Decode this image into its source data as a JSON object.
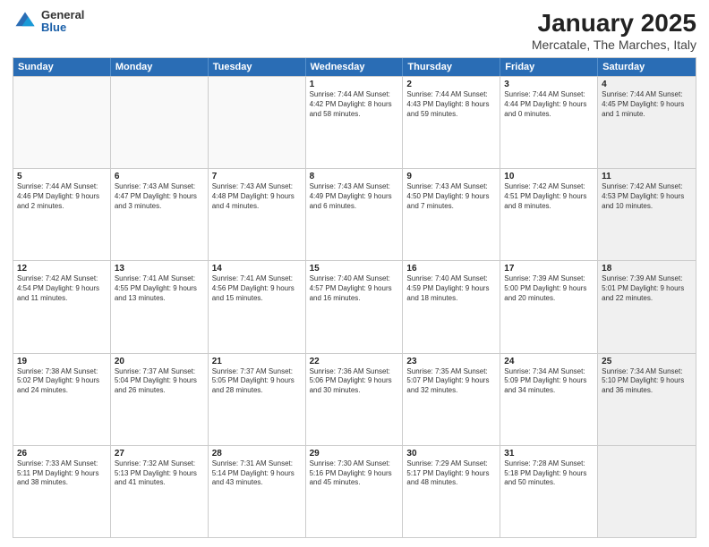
{
  "logo": {
    "general": "General",
    "blue": "Blue"
  },
  "header": {
    "title": "January 2025",
    "subtitle": "Mercatale, The Marches, Italy"
  },
  "weekdays": [
    "Sunday",
    "Monday",
    "Tuesday",
    "Wednesday",
    "Thursday",
    "Friday",
    "Saturday"
  ],
  "rows": [
    [
      {
        "day": "",
        "text": "",
        "empty": true
      },
      {
        "day": "",
        "text": "",
        "empty": true
      },
      {
        "day": "",
        "text": "",
        "empty": true
      },
      {
        "day": "1",
        "text": "Sunrise: 7:44 AM\nSunset: 4:42 PM\nDaylight: 8 hours and 58 minutes."
      },
      {
        "day": "2",
        "text": "Sunrise: 7:44 AM\nSunset: 4:43 PM\nDaylight: 8 hours and 59 minutes."
      },
      {
        "day": "3",
        "text": "Sunrise: 7:44 AM\nSunset: 4:44 PM\nDaylight: 9 hours and 0 minutes."
      },
      {
        "day": "4",
        "text": "Sunrise: 7:44 AM\nSunset: 4:45 PM\nDaylight: 9 hours and 1 minute.",
        "shaded": true
      }
    ],
    [
      {
        "day": "5",
        "text": "Sunrise: 7:44 AM\nSunset: 4:46 PM\nDaylight: 9 hours and 2 minutes."
      },
      {
        "day": "6",
        "text": "Sunrise: 7:43 AM\nSunset: 4:47 PM\nDaylight: 9 hours and 3 minutes."
      },
      {
        "day": "7",
        "text": "Sunrise: 7:43 AM\nSunset: 4:48 PM\nDaylight: 9 hours and 4 minutes."
      },
      {
        "day": "8",
        "text": "Sunrise: 7:43 AM\nSunset: 4:49 PM\nDaylight: 9 hours and 6 minutes."
      },
      {
        "day": "9",
        "text": "Sunrise: 7:43 AM\nSunset: 4:50 PM\nDaylight: 9 hours and 7 minutes."
      },
      {
        "day": "10",
        "text": "Sunrise: 7:42 AM\nSunset: 4:51 PM\nDaylight: 9 hours and 8 minutes."
      },
      {
        "day": "11",
        "text": "Sunrise: 7:42 AM\nSunset: 4:53 PM\nDaylight: 9 hours and 10 minutes.",
        "shaded": true
      }
    ],
    [
      {
        "day": "12",
        "text": "Sunrise: 7:42 AM\nSunset: 4:54 PM\nDaylight: 9 hours and 11 minutes."
      },
      {
        "day": "13",
        "text": "Sunrise: 7:41 AM\nSunset: 4:55 PM\nDaylight: 9 hours and 13 minutes."
      },
      {
        "day": "14",
        "text": "Sunrise: 7:41 AM\nSunset: 4:56 PM\nDaylight: 9 hours and 15 minutes."
      },
      {
        "day": "15",
        "text": "Sunrise: 7:40 AM\nSunset: 4:57 PM\nDaylight: 9 hours and 16 minutes."
      },
      {
        "day": "16",
        "text": "Sunrise: 7:40 AM\nSunset: 4:59 PM\nDaylight: 9 hours and 18 minutes."
      },
      {
        "day": "17",
        "text": "Sunrise: 7:39 AM\nSunset: 5:00 PM\nDaylight: 9 hours and 20 minutes."
      },
      {
        "day": "18",
        "text": "Sunrise: 7:39 AM\nSunset: 5:01 PM\nDaylight: 9 hours and 22 minutes.",
        "shaded": true
      }
    ],
    [
      {
        "day": "19",
        "text": "Sunrise: 7:38 AM\nSunset: 5:02 PM\nDaylight: 9 hours and 24 minutes."
      },
      {
        "day": "20",
        "text": "Sunrise: 7:37 AM\nSunset: 5:04 PM\nDaylight: 9 hours and 26 minutes."
      },
      {
        "day": "21",
        "text": "Sunrise: 7:37 AM\nSunset: 5:05 PM\nDaylight: 9 hours and 28 minutes."
      },
      {
        "day": "22",
        "text": "Sunrise: 7:36 AM\nSunset: 5:06 PM\nDaylight: 9 hours and 30 minutes."
      },
      {
        "day": "23",
        "text": "Sunrise: 7:35 AM\nSunset: 5:07 PM\nDaylight: 9 hours and 32 minutes."
      },
      {
        "day": "24",
        "text": "Sunrise: 7:34 AM\nSunset: 5:09 PM\nDaylight: 9 hours and 34 minutes."
      },
      {
        "day": "25",
        "text": "Sunrise: 7:34 AM\nSunset: 5:10 PM\nDaylight: 9 hours and 36 minutes.",
        "shaded": true
      }
    ],
    [
      {
        "day": "26",
        "text": "Sunrise: 7:33 AM\nSunset: 5:11 PM\nDaylight: 9 hours and 38 minutes."
      },
      {
        "day": "27",
        "text": "Sunrise: 7:32 AM\nSunset: 5:13 PM\nDaylight: 9 hours and 41 minutes."
      },
      {
        "day": "28",
        "text": "Sunrise: 7:31 AM\nSunset: 5:14 PM\nDaylight: 9 hours and 43 minutes."
      },
      {
        "day": "29",
        "text": "Sunrise: 7:30 AM\nSunset: 5:16 PM\nDaylight: 9 hours and 45 minutes."
      },
      {
        "day": "30",
        "text": "Sunrise: 7:29 AM\nSunset: 5:17 PM\nDaylight: 9 hours and 48 minutes."
      },
      {
        "day": "31",
        "text": "Sunrise: 7:28 AM\nSunset: 5:18 PM\nDaylight: 9 hours and 50 minutes."
      },
      {
        "day": "",
        "text": "",
        "empty": true,
        "shaded": true
      }
    ]
  ]
}
